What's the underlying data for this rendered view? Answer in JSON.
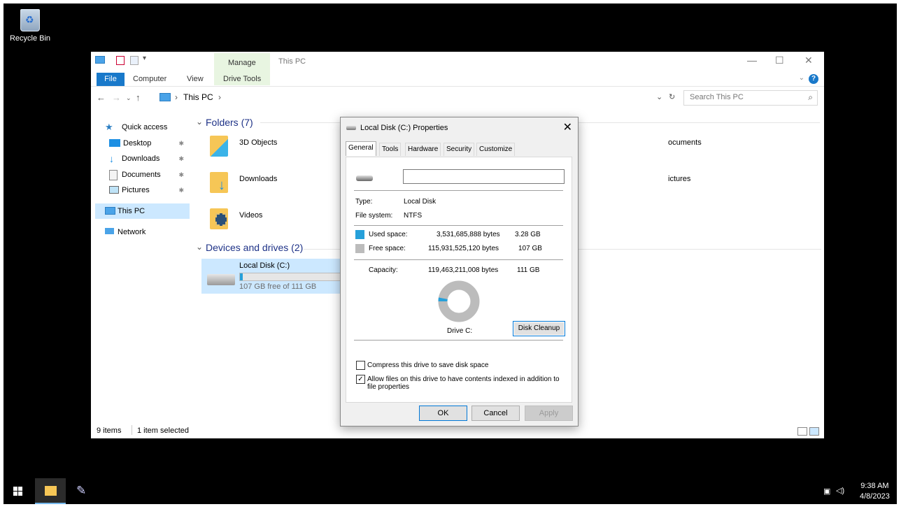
{
  "desktop": {
    "recycle_bin_label": "Recycle Bin"
  },
  "explorer": {
    "title": "This PC",
    "context_tab_group": "Manage",
    "ribbon_tabs": {
      "file": "File",
      "computer": "Computer",
      "view": "View",
      "drive_tools": "Drive Tools"
    },
    "address": {
      "path": "This PC",
      "separator": "›"
    },
    "search_placeholder": "Search This PC",
    "nav": {
      "quick_access": "Quick access",
      "desktop": "Desktop",
      "downloads": "Downloads",
      "documents": "Documents",
      "pictures": "Pictures",
      "this_pc": "This PC",
      "network": "Network"
    },
    "groups": {
      "folders": "Folders (7)",
      "devices": "Devices and drives (2)"
    },
    "folders": {
      "objects3d": "3D Objects",
      "downloads": "Downloads",
      "videos": "Videos",
      "documents_partial": "ocuments",
      "pictures_partial": "ictures"
    },
    "drive": {
      "name": "Local Disk (C:)",
      "free_text": "107 GB free of 111 GB",
      "used_fraction": 0.03
    },
    "status": {
      "items": "9 items",
      "selected": "1 item selected"
    }
  },
  "dialog": {
    "title": "Local Disk (C:) Properties",
    "tabs": {
      "general": "General",
      "tools": "Tools",
      "hardware": "Hardware",
      "security": "Security",
      "customize": "Customize"
    },
    "name_value": "",
    "type_label": "Type:",
    "type_value": "Local Disk",
    "fs_label": "File system:",
    "fs_value": "NTFS",
    "used_label": "Used space:",
    "used_bytes": "3,531,685,888 bytes",
    "used_gb": "3.28 GB",
    "free_label": "Free space:",
    "free_bytes": "115,931,525,120 bytes",
    "free_gb": "107 GB",
    "capacity_label": "Capacity:",
    "capacity_bytes": "119,463,211,008 bytes",
    "capacity_gb": "111 GB",
    "drive_label": "Drive C:",
    "cleanup_button": "Disk Cleanup",
    "compress_label": "Compress this drive to save disk space",
    "compress_checked": false,
    "index_label_line1": "Allow files on this drive to have contents indexed in addition to",
    "index_label_line2": "file properties",
    "index_checked": true,
    "ok": "OK",
    "cancel": "Cancel",
    "apply": "Apply",
    "used_color": "#26a0da",
    "free_color": "#bcbcbc",
    "used_fraction": 0.0296
  },
  "taskbar": {
    "time": "9:38 AM",
    "date": "4/8/2023"
  }
}
